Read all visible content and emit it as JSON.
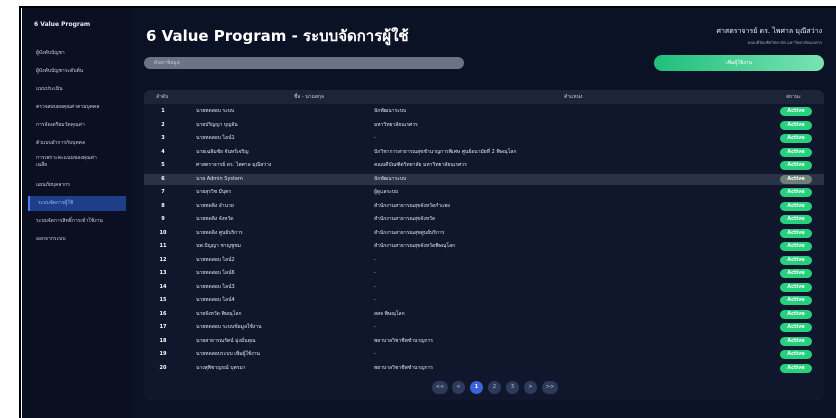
{
  "app": {
    "brand": "6 Value Program",
    "page_title": "6 Value Program - ระบบจัดการผู้ใช้",
    "user": {
      "name": "ศาสตราจารย์ ดร. ไพศาล มุณีสว่าง",
      "role": "คณบดีบัณฑิตวิทยาลัย มหาวิทยาลัยนเรศวร"
    }
  },
  "sidebar": {
    "items": [
      {
        "label": "ผู้บังคับบัญชา",
        "active": false
      },
      {
        "label": "ผู้บังคับบัญชาระดับต้น",
        "active": false
      },
      {
        "label": "แบบประเมิน",
        "active": false
      },
      {
        "label": "ตรวจสอบผลคุณค่าตามบุคคล",
        "active": false
      },
      {
        "label": "การจัดเตรียมวัดคุณค่า",
        "active": false
      },
      {
        "label": "ตัวแบบอำการกับบุคคล",
        "active": false
      },
      {
        "label": "การเพราะคะแนนของคุณค่า",
        "label2": "เฉลี่ย",
        "active": false
      },
      {
        "label": "แผนภัยบุคลากร",
        "active": false
      },
      {
        "label": "ระบบจัดการผู้ใช้",
        "active": true
      },
      {
        "label": "ระบบจัดการสิทธิ์การเข้าใช้งาน",
        "active": false
      },
      {
        "label": "ออกจากระบบ",
        "active": false
      }
    ]
  },
  "toolbar": {
    "search_placeholder": "ค้นหาข้อมูล",
    "add_label": "เพิ่มผู้ใช้งาน"
  },
  "table": {
    "headers": {
      "no": "ลำดับ",
      "name": "ชื่อ - นามสกุล",
      "dept": "ตำแหน่ง",
      "status": "สถานะ"
    },
    "rows": [
      {
        "no": "1",
        "name": "นายทดสอบ ระบบ",
        "dept": "นักพัฒนาระบบ",
        "status": "Active"
      },
      {
        "no": "2",
        "name": "นายปริญญา บุญจัน",
        "dept": "มหาวิทยาลัยนเรศวร",
        "status": "Active"
      },
      {
        "no": "3",
        "name": "นายทดสอบ ไลน์1",
        "dept": "-",
        "status": "Active"
      },
      {
        "no": "4",
        "name": "นายเฉลิมชัย จันทร์เจริญ",
        "dept": "นักวิชาการสาธารณสุขชำนาญการพิเศษ ศูนย์อนามัยที่ 2 พิษณุโลก",
        "status": "Active"
      },
      {
        "no": "5",
        "name": "ศาสตราจารย์ ดร. ไพศาล มุณีสว่าง",
        "dept": "คณบดีบัณฑิตวิทยาลัย มหาวิทยาลัยนเรศวร",
        "status": "Active"
      },
      {
        "no": "6",
        "name": "นาย Admin System",
        "dept": "นักพัฒนาระบบ",
        "status": "Active"
      },
      {
        "no": "7",
        "name": "นายสุรวิช มีบุตร",
        "dept": "ผู้ดูแลระบบ",
        "status": "Active"
      },
      {
        "no": "8",
        "name": "นายทดลิง อำนวย",
        "dept": "สำนักงานสาธารณสุขจังหวัดกำแพง",
        "status": "Active"
      },
      {
        "no": "9",
        "name": "นายทดลิง จังหวัด",
        "dept": "สำนักงานสาธารณสุขจังหวัด",
        "status": "Active"
      },
      {
        "no": "10",
        "name": "นายทดลิง ศูนย์บริการ",
        "dept": "สำนักงานสาธารณสุขศูนย์บริการ",
        "status": "Active"
      },
      {
        "no": "11",
        "name": "นพ.ปัญญา ชาญชูชม",
        "dept": "สำนักงานสาธารณสุขจังหวัดพิษณุโลก",
        "status": "Active"
      },
      {
        "no": "12",
        "name": "นายทดสอบ ไลน์2",
        "dept": "-",
        "status": "Active"
      },
      {
        "no": "13",
        "name": "นายทดสอบ ไลน์6",
        "dept": "-",
        "status": "Active"
      },
      {
        "no": "14",
        "name": "นายทดสอบ ไลน์3",
        "dept": "-",
        "status": "Active"
      },
      {
        "no": "15",
        "name": "นายทดสอบ ไลน์4",
        "dept": "-",
        "status": "Active"
      },
      {
        "no": "16",
        "name": "นายจังหวัด พิษณุโลก",
        "dept": "สสจ พิษณุโลก",
        "status": "Active"
      },
      {
        "no": "17",
        "name": "นายทดสอบ ระบบข้อมูลใช้งาน",
        "dept": "-",
        "status": "Active"
      },
      {
        "no": "18",
        "name": "นายสาธารณรัตน์ มุ่งมั่นคุณ",
        "dept": "พยาบาลวิชาชีพชำนาญการ",
        "status": "Active"
      },
      {
        "no": "19",
        "name": "นายทดสอบระบบ เพิ่มผู้ใช้งาน",
        "dept": "-",
        "status": "Active"
      },
      {
        "no": "20",
        "name": "นางสุพิชาญรณ์ บุตรมา",
        "dept": "พยาบาลวิชาชีพชำนาญการ",
        "status": "Active"
      }
    ]
  },
  "pagination": {
    "first": "<<",
    "prev": "<",
    "pages": [
      "1",
      "2",
      "3"
    ],
    "current": "1",
    "next": ">",
    "last": ">>"
  },
  "colors": {
    "background": "#0c1226",
    "accent": "#3e63d9",
    "active_badge": "#26d07c",
    "add_button": "#1fbf7a"
  }
}
